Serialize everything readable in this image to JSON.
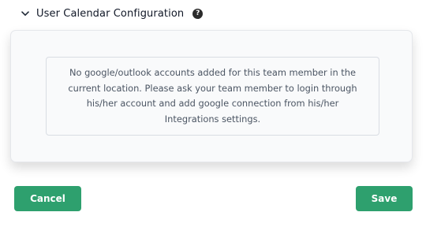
{
  "section": {
    "title": "User Calendar Configuration",
    "help_glyph": "?",
    "chevron_icon": "chevron-down-icon",
    "help_icon": "question-circle-icon"
  },
  "notice": {
    "lines": [
      "No google/outlook accounts added for this team member in the",
      "current location. Please ask your team member to login through",
      "his/her account and add google connection from his/her",
      "Integrations settings."
    ]
  },
  "actions": {
    "cancel_label": "Cancel",
    "save_label": "Save"
  },
  "colors": {
    "button_bg": "#2ea06e",
    "panel_bg": "#f9fafb",
    "help_icon_bg": "#2b2b2b"
  }
}
